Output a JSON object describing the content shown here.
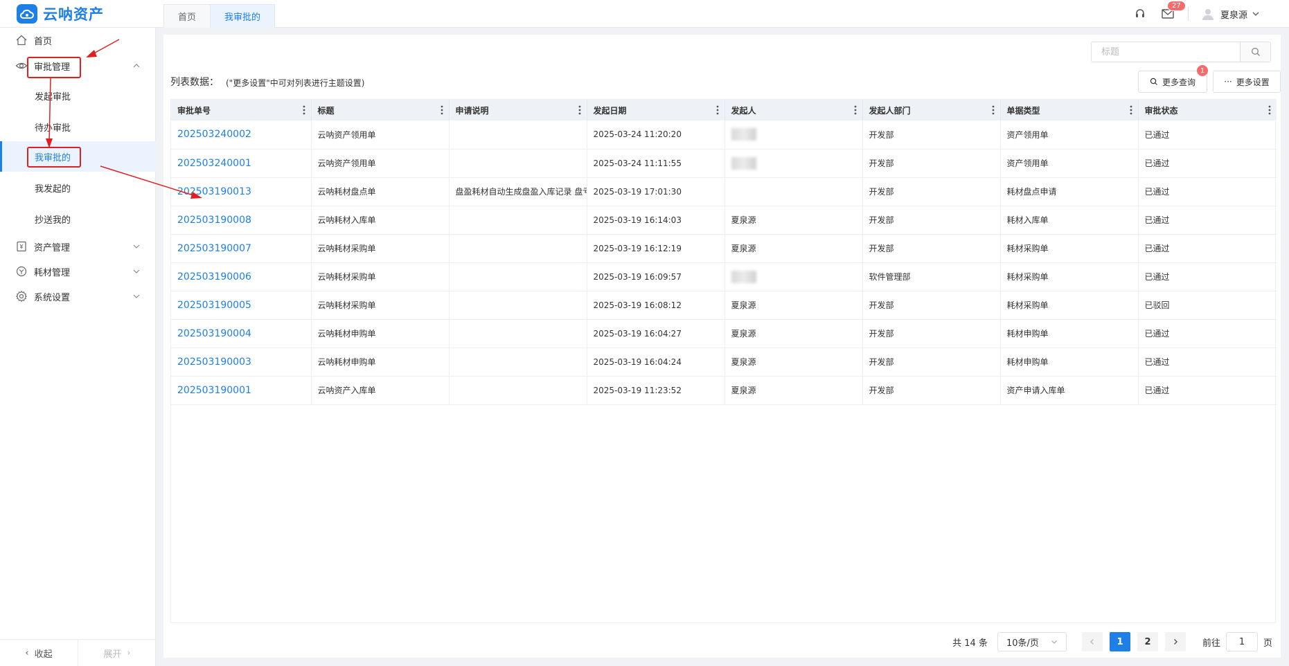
{
  "app": {
    "logo_text": "云呐资产"
  },
  "tabs": [
    {
      "label": "首页"
    },
    {
      "label": "我审批的"
    }
  ],
  "header": {
    "mail_badge": "27",
    "user_name": "夏泉源"
  },
  "sidebar": {
    "items": [
      {
        "label": "首页"
      },
      {
        "label": "审批管理"
      },
      {
        "label": "资产管理"
      },
      {
        "label": "耗材管理"
      },
      {
        "label": "系统设置"
      }
    ],
    "sub_items": [
      {
        "label": "发起审批"
      },
      {
        "label": "待办审批"
      },
      {
        "label": "我审批的"
      },
      {
        "label": "我发起的"
      },
      {
        "label": "抄送我的"
      }
    ],
    "collapse_label": "收起",
    "expand_label": "展开"
  },
  "search": {
    "placeholder": "标题"
  },
  "list": {
    "title": "列表数据：",
    "hint": "(\"更多设置\"中可对列表进行主题设置)",
    "more_query_label": "更多查询",
    "more_query_badge": "1",
    "more_settings_label": "更多设置"
  },
  "table": {
    "columns": [
      "审批单号",
      "标题",
      "申请说明",
      "发起日期",
      "发起人",
      "发起人部门",
      "单据类型",
      "审批状态"
    ],
    "rows": [
      {
        "id": "202503240002",
        "title": "云呐资产领用单",
        "desc": "",
        "date": "2025-03-24 11:20:20",
        "initiator": "",
        "dept": "开发部",
        "type": "资产领用单",
        "status": "已通过"
      },
      {
        "id": "202503240001",
        "title": "云呐资产领用单",
        "desc": "",
        "date": "2025-03-24 11:11:55",
        "initiator": "",
        "dept": "开发部",
        "type": "资产领用单",
        "status": "已通过"
      },
      {
        "id": "202503190013",
        "title": "云呐耗材盘点单",
        "desc": "盘盈耗材自动生成盘盈入库记录 盘亏",
        "date": "2025-03-19 17:01:30",
        "initiator": "",
        "dept": "开发部",
        "type": "耗材盘点申请",
        "status": "已通过"
      },
      {
        "id": "202503190008",
        "title": "云呐耗材入库单",
        "desc": "",
        "date": "2025-03-19 16:14:03",
        "initiator": "夏泉源",
        "dept": "开发部",
        "type": "耗材入库单",
        "status": "已通过"
      },
      {
        "id": "202503190007",
        "title": "云呐耗材采购单",
        "desc": "",
        "date": "2025-03-19 16:12:19",
        "initiator": "夏泉源",
        "dept": "开发部",
        "type": "耗材采购单",
        "status": "已通过"
      },
      {
        "id": "202503190006",
        "title": "云呐耗材采购单",
        "desc": "",
        "date": "2025-03-19 16:09:57",
        "initiator": "",
        "dept": "软件管理部",
        "type": "耗材采购单",
        "status": "已通过"
      },
      {
        "id": "202503190005",
        "title": "云呐耗材采购单",
        "desc": "",
        "date": "2025-03-19 16:08:12",
        "initiator": "夏泉源",
        "dept": "开发部",
        "type": "耗材采购单",
        "status": "已驳回"
      },
      {
        "id": "202503190004",
        "title": "云呐耗材申购单",
        "desc": "",
        "date": "2025-03-19 16:04:27",
        "initiator": "夏泉源",
        "dept": "开发部",
        "type": "耗材申购单",
        "status": "已通过"
      },
      {
        "id": "202503190003",
        "title": "云呐耗材申购单",
        "desc": "",
        "date": "2025-03-19 16:04:24",
        "initiator": "夏泉源",
        "dept": "开发部",
        "type": "耗材申购单",
        "status": "已通过"
      },
      {
        "id": "202503190001",
        "title": "云呐资产入库单",
        "desc": "",
        "date": "2025-03-19 11:23:52",
        "initiator": "夏泉源",
        "dept": "开发部",
        "type": "资产申请入库单",
        "status": "已通过"
      }
    ]
  },
  "pager": {
    "total": "共 14 条",
    "page_size": "10条/页",
    "pages": [
      "1",
      "2"
    ],
    "goto_label": "前往",
    "goto_value": "1",
    "page_unit": "页"
  },
  "colors": {
    "primary": "#1e7fe6",
    "badge": "#f56c6c",
    "annotation": "#e02020"
  }
}
